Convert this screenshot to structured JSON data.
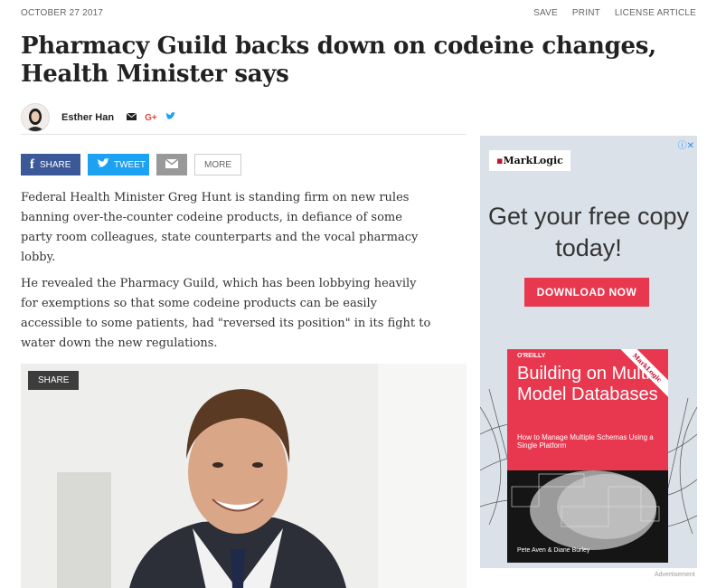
{
  "header": {
    "date": "OCTOBER 27 2017",
    "actions": [
      "SAVE",
      "PRINT",
      "LICENSE ARTICLE"
    ]
  },
  "article": {
    "title": "Pharmacy Guild backs down on codeine changes, Health Minister says",
    "author": "Esther Han",
    "author_icons": [
      "email-icon",
      "google-plus-icon",
      "twitter-icon"
    ],
    "paragraphs": [
      "Federal Health Minister Greg Hunt is standing firm on new rules banning over-the-counter codeine products, in defiance of some party room colleagues, state counterparts and the vocal pharmacy lobby.",
      "He revealed the Pharmacy Guild, which has been lobbying heavily for exemptions so that some codeine products can be easily accessible to some patients, had \"reversed its position\" in its fight to water down the new regulations."
    ],
    "photo_share_label": "SHARE"
  },
  "share_bar": {
    "facebook_label": "SHARE",
    "twitter_label": "TWEET",
    "more_label": "MORE"
  },
  "ad": {
    "logo_text": "MarkLogic",
    "headline": "Get your free copy today!",
    "cta": "DOWNLOAD NOW",
    "book_publisher": "O'REILLY",
    "book_title": "Building on Multi-Model Databases",
    "book_subtitle": "How to Manage Multiple Schemas Using a Single Platform",
    "book_authors": "Pete Aven & Diane Burley",
    "book_corner": "MarkLogic",
    "label": "Advertisement"
  },
  "colors": {
    "facebook": "#3b5998",
    "twitter": "#1da1f2",
    "ad_accent": "#e8384f"
  }
}
